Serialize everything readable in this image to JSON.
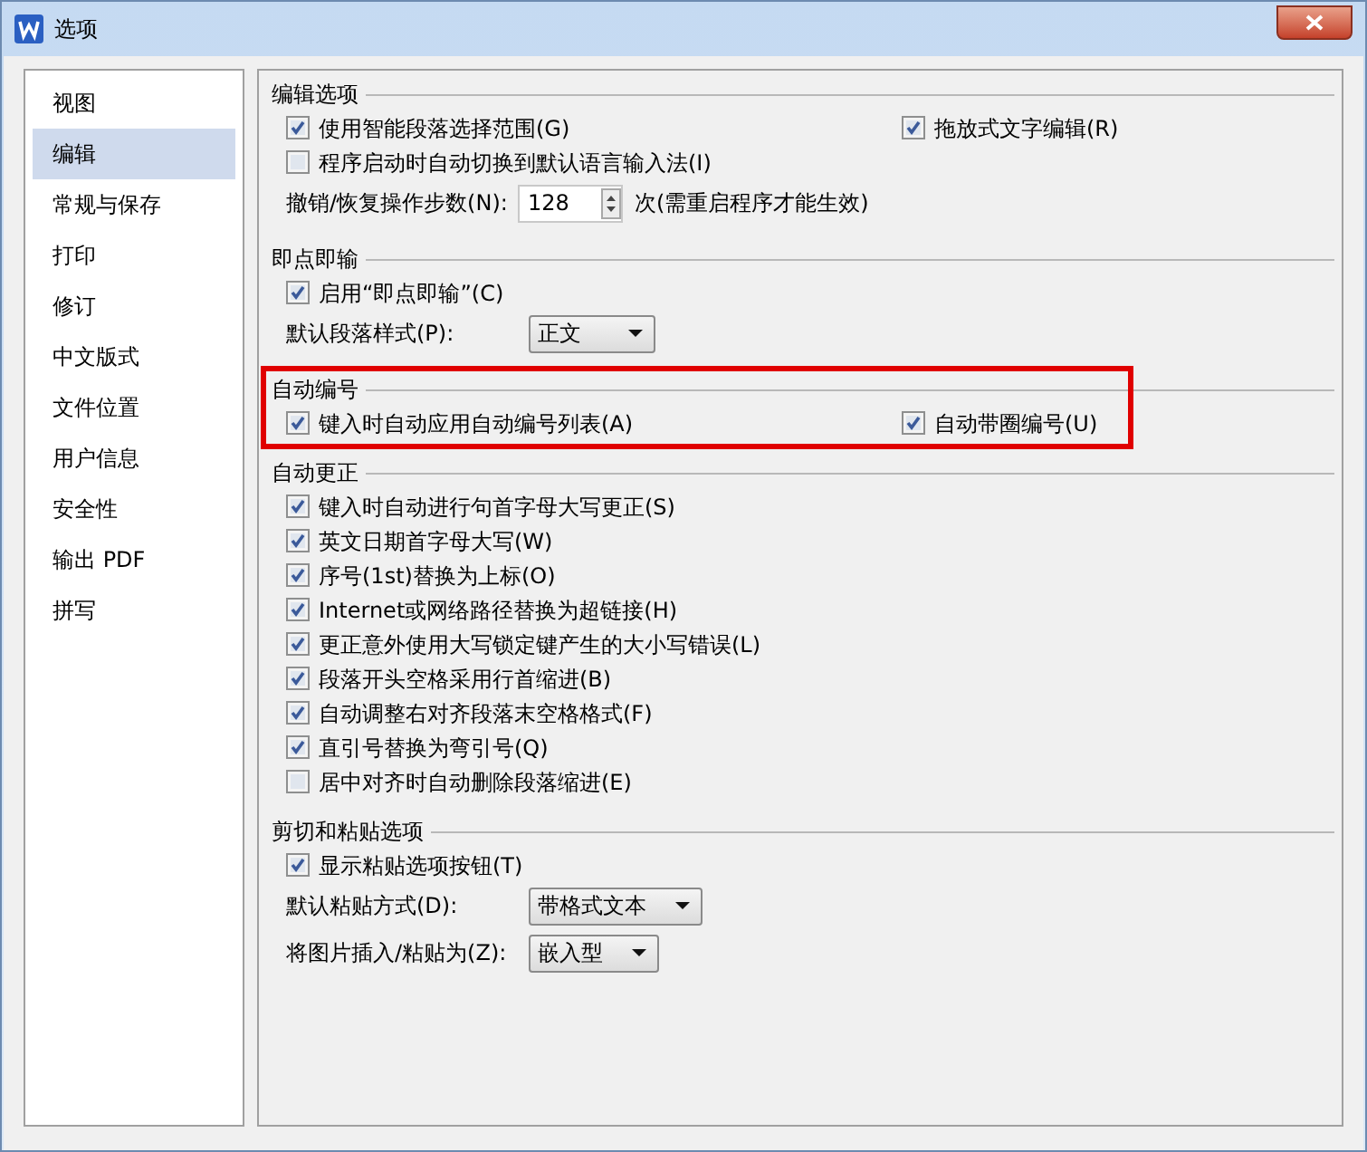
{
  "window": {
    "title": "选项"
  },
  "sidebar": {
    "items": [
      {
        "label": "视图",
        "selected": false
      },
      {
        "label": "编辑",
        "selected": true
      },
      {
        "label": "常规与保存",
        "selected": false
      },
      {
        "label": "打印",
        "selected": false
      },
      {
        "label": "修订",
        "selected": false
      },
      {
        "label": "中文版式",
        "selected": false
      },
      {
        "label": "文件位置",
        "selected": false
      },
      {
        "label": "用户信息",
        "selected": false
      },
      {
        "label": "安全性",
        "selected": false
      },
      {
        "label": "输出 PDF",
        "selected": false
      },
      {
        "label": "拼写",
        "selected": false
      }
    ]
  },
  "sections": [
    {
      "title": "编辑选项",
      "highlighted": false,
      "rows": [
        {
          "kind": "checkboxes",
          "items": [
            {
              "label": "使用智能段落选择范围(G)",
              "checked": true
            },
            {
              "label": "拖放式文字编辑(R)",
              "checked": true
            }
          ]
        },
        {
          "kind": "checkboxes",
          "items": [
            {
              "label": "程序启动时自动切换到默认语言输入法(I)",
              "checked": false
            }
          ]
        },
        {
          "kind": "spinner",
          "label": "撤销/恢复操作步数(N):",
          "value": "128",
          "suffix": "次(需重启程序才能生效)"
        }
      ]
    },
    {
      "title": "即点即输",
      "highlighted": false,
      "rows": [
        {
          "kind": "checkboxes",
          "items": [
            {
              "label": "启用“即点即输”(C)",
              "checked": true
            }
          ]
        },
        {
          "kind": "dropdown",
          "label": "默认段落样式(P):",
          "value": "正文"
        }
      ]
    },
    {
      "title": "自动编号",
      "highlighted": true,
      "rows": [
        {
          "kind": "checkboxes",
          "items": [
            {
              "label": "键入时自动应用自动编号列表(A)",
              "checked": true
            },
            {
              "label": "自动带圈编号(U)",
              "checked": true
            }
          ]
        }
      ]
    },
    {
      "title": "自动更正",
      "highlighted": false,
      "rows": [
        {
          "kind": "checkboxes",
          "items": [
            {
              "label": "键入时自动进行句首字母大写更正(S)",
              "checked": true
            }
          ]
        },
        {
          "kind": "checkboxes",
          "items": [
            {
              "label": "英文日期首字母大写(W)",
              "checked": true
            }
          ]
        },
        {
          "kind": "checkboxes",
          "items": [
            {
              "label": "序号(1st)替换为上标(O)",
              "checked": true
            }
          ]
        },
        {
          "kind": "checkboxes",
          "items": [
            {
              "label": "Internet或网络路径替换为超链接(H)",
              "checked": true
            }
          ]
        },
        {
          "kind": "checkboxes",
          "items": [
            {
              "label": "更正意外使用大写锁定键产生的大小写错误(L)",
              "checked": true
            }
          ]
        },
        {
          "kind": "checkboxes",
          "items": [
            {
              "label": "段落开头空格采用行首缩进(B)",
              "checked": true
            }
          ]
        },
        {
          "kind": "checkboxes",
          "items": [
            {
              "label": "自动调整右对齐段落末空格格式(F)",
              "checked": true
            }
          ]
        },
        {
          "kind": "checkboxes",
          "items": [
            {
              "label": "直引号替换为弯引号(Q)",
              "checked": true
            }
          ]
        },
        {
          "kind": "checkboxes",
          "items": [
            {
              "label": "居中对齐时自动删除段落缩进(E)",
              "checked": false
            }
          ]
        }
      ]
    },
    {
      "title": "剪切和粘贴选项",
      "highlighted": false,
      "rows": [
        {
          "kind": "checkboxes",
          "items": [
            {
              "label": "显示粘贴选项按钮(T)",
              "checked": true
            }
          ]
        },
        {
          "kind": "dropdown",
          "label": "默认粘贴方式(D):",
          "value": "带格式文本"
        },
        {
          "kind": "dropdown",
          "label": "将图片插入/粘贴为(Z):",
          "value": "嵌入型"
        }
      ]
    }
  ]
}
